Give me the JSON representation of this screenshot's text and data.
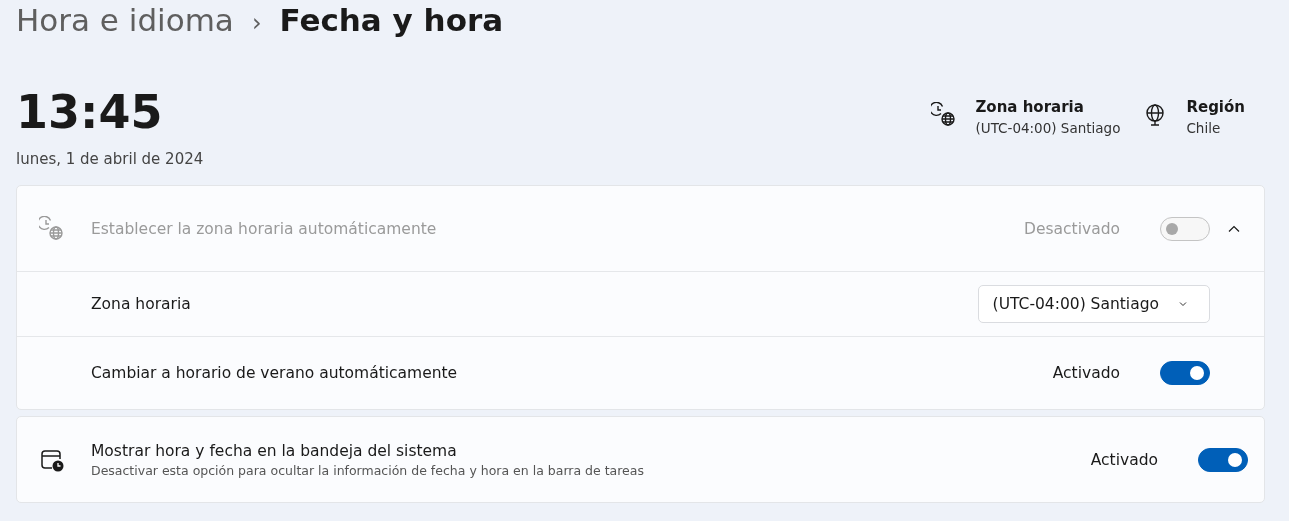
{
  "breadcrumb": {
    "parent": "Hora e idioma",
    "separator": "›",
    "current": "Fecha y hora"
  },
  "clock": {
    "time": "13:45",
    "date": "lunes, 1 de abril de 2024"
  },
  "summary": [
    {
      "kind": "timezone",
      "label": "Zona horaria",
      "value": "(UTC-04:00) Santiago"
    },
    {
      "kind": "region",
      "label": "Región",
      "value": "Chile"
    }
  ],
  "auto_timezone": {
    "label": "Establecer la zona horaria automáticamente",
    "disabled": true,
    "state_text": "Desactivado",
    "on": false,
    "expanded": true,
    "rows": [
      {
        "kind": "dropdown",
        "label": "Zona horaria",
        "value": "(UTC-04:00) Santiago"
      },
      {
        "kind": "toggle",
        "label": "Cambiar a horario de verano automáticamente",
        "state_text": "Activado",
        "on": true
      }
    ]
  },
  "tray": {
    "label": "Mostrar hora y fecha en la bandeja del sistema",
    "description": "Desactivar esta opción para ocultar la información de fecha y hora en la barra de tareas",
    "state_text": "Activado",
    "on": true
  }
}
